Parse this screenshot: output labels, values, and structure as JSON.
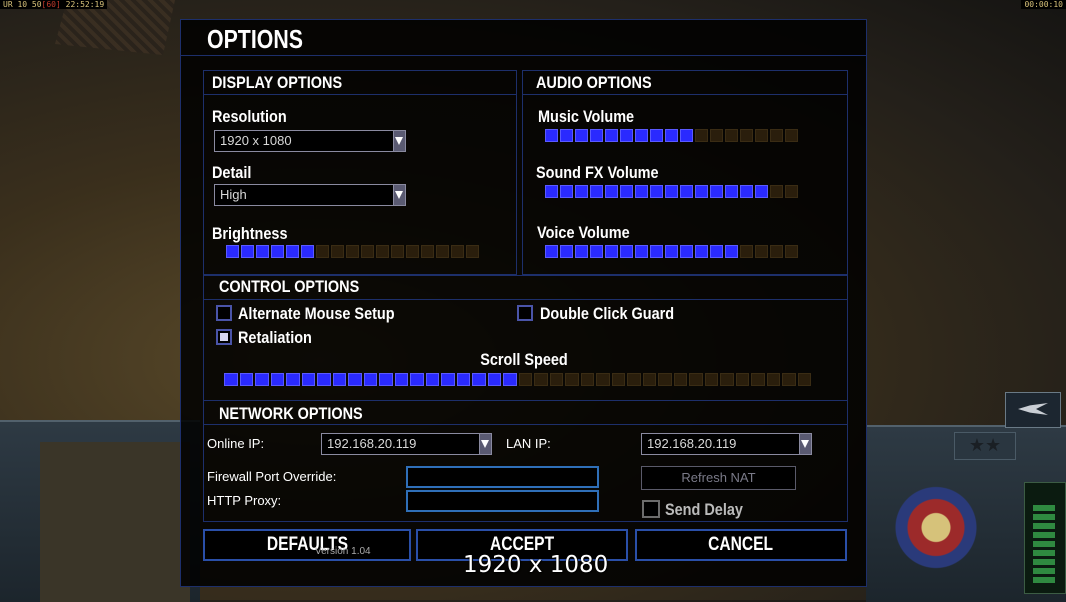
{
  "hud": {
    "top_left": "UR 10 50",
    "fps": "[60]",
    "clock": "22:52:19",
    "top_right": "00:00:10"
  },
  "dialog": {
    "title": "OPTIONS",
    "version": "Version 1.04"
  },
  "display": {
    "title": "DISPLAY OPTIONS",
    "resolution_label": "Resolution",
    "resolution_value": "1920 x 1080",
    "detail_label": "Detail",
    "detail_value": "High",
    "brightness_label": "Brightness",
    "brightness_level": {
      "filled": 6,
      "total": 17
    }
  },
  "audio": {
    "title": "AUDIO OPTIONS",
    "music_label": "Music Volume",
    "music_level": {
      "filled": 10,
      "total": 17
    },
    "sfx_label": "Sound FX Volume",
    "sfx_level": {
      "filled": 15,
      "total": 17
    },
    "voice_label": "Voice Volume",
    "voice_level": {
      "filled": 13,
      "total": 17
    }
  },
  "control": {
    "title": "CONTROL OPTIONS",
    "alternate_mouse_label": "Alternate Mouse Setup",
    "alternate_mouse_checked": false,
    "double_click_label": "Double Click Guard",
    "double_click_checked": false,
    "retaliation_label": "Retaliation",
    "retaliation_checked": true,
    "scroll_speed_label": "Scroll Speed",
    "scroll_speed_level": {
      "filled": 19,
      "total": 38
    }
  },
  "network": {
    "title": "NETWORK OPTIONS",
    "online_ip_label": "Online IP:",
    "online_ip_value": "192.168.20.119",
    "lan_ip_label": "LAN IP:",
    "lan_ip_value": "192.168.20.119",
    "firewall_label": "Firewall Port Override:",
    "firewall_value": "",
    "proxy_label": "HTTP Proxy:",
    "proxy_value": "",
    "refresh_nat_label": "Refresh NAT",
    "send_delay_label": "Send Delay",
    "send_delay_checked": false
  },
  "buttons": {
    "defaults": "DEFAULTS",
    "accept": "ACCEPT",
    "cancel": "CANCEL"
  },
  "overlay_resolution": "1920 x 1080",
  "colors": {
    "slider_on": "#2a2aff",
    "slider_off": "#2a1e0c",
    "frame": "#1d2f6b",
    "button_border": "#2a4fa8"
  }
}
